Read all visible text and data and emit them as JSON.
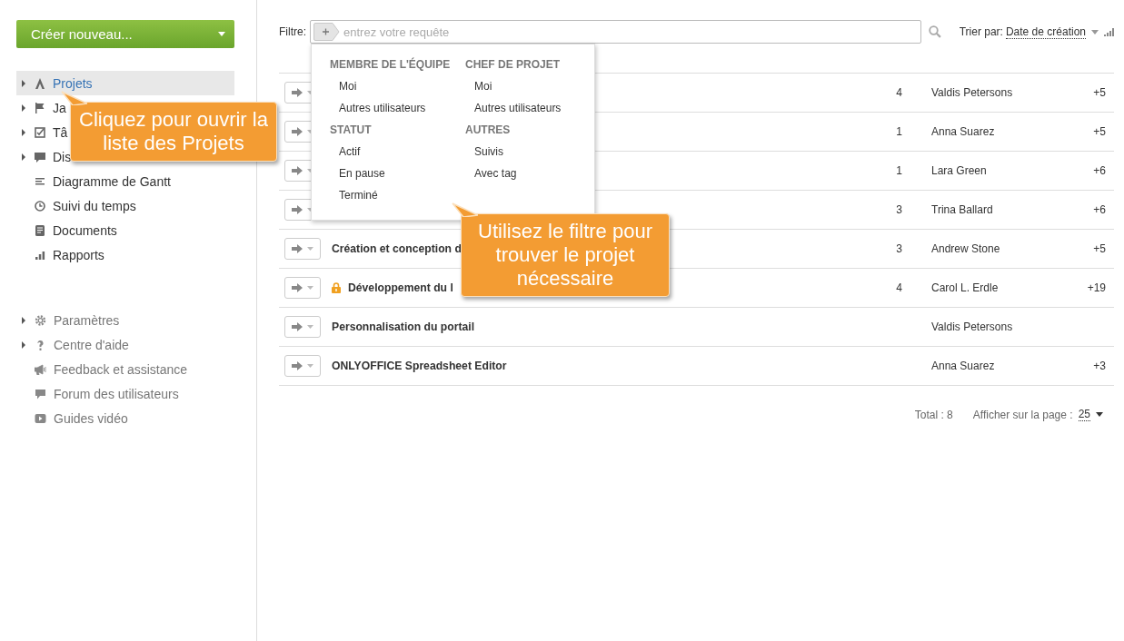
{
  "create_button": {
    "label": "Créer nouveau..."
  },
  "sidebar": {
    "items": [
      {
        "label": "Projets",
        "expandable": true,
        "selected": true
      },
      {
        "label": "Ja",
        "expandable": true,
        "selected": false
      },
      {
        "label": "Tâ",
        "expandable": true,
        "selected": false
      },
      {
        "label": "Dis",
        "expandable": true,
        "selected": false
      },
      {
        "label": "Diagramme de Gantt",
        "expandable": false,
        "selected": false
      },
      {
        "label": "Suivi du temps",
        "expandable": false,
        "selected": false
      },
      {
        "label": "Documents",
        "expandable": false,
        "selected": false
      },
      {
        "label": "Rapports",
        "expandable": false,
        "selected": false
      }
    ],
    "help_items": [
      {
        "label": "Paramètres",
        "expandable": true
      },
      {
        "label": "Centre d'aide",
        "expandable": true
      },
      {
        "label": "Feedback et assistance",
        "expandable": false
      },
      {
        "label": "Forum des utilisateurs",
        "expandable": false
      },
      {
        "label": "Guides vidéo",
        "expandable": false
      }
    ]
  },
  "filter": {
    "label": "Filtre:",
    "placeholder": "entrez votre requête"
  },
  "sort": {
    "label": "Trier par:",
    "value": "Date de création"
  },
  "filter_menu": {
    "groups": [
      {
        "title": "MEMBRE DE L'ÉQUIPE",
        "options": [
          "Moi",
          "Autres utilisateurs"
        ]
      },
      {
        "title": "CHEF DE PROJET",
        "options": [
          "Moi",
          "Autres utilisateurs"
        ]
      },
      {
        "title": "STATUT",
        "options": [
          "Actif",
          "En pause",
          "Terminé"
        ]
      },
      {
        "title": "AUTRES",
        "options": [
          "Suivis",
          "Avec tag"
        ]
      }
    ]
  },
  "projects": [
    {
      "count": "4",
      "manager": "Valdis Petersons",
      "extra": "+5"
    },
    {
      "count": "1",
      "manager": "Anna Suarez",
      "extra": "+5"
    },
    {
      "count": "1",
      "manager": "Lara Green",
      "extra": "+6"
    },
    {
      "count": "3",
      "manager": "Trina Ballard",
      "extra": "+6"
    },
    {
      "name": "Création et conception d",
      "locked": false,
      "count": "3",
      "manager": "Andrew Stone",
      "extra": "+5"
    },
    {
      "name": "Développement du l",
      "locked": true,
      "count": "4",
      "manager": "Carol L. Erdle",
      "extra": "+19"
    },
    {
      "name": "Personnalisation du portail",
      "locked": false,
      "manager": "Valdis Petersons"
    },
    {
      "name": "ONLYOFFICE Spreadsheet Editor",
      "locked": false,
      "manager": "Anna Suarez",
      "extra": "+3"
    }
  ],
  "pagination": {
    "total": "Total : 8",
    "page_size_label": "Afficher sur la page :",
    "page_size": "25"
  },
  "callouts": [
    {
      "text": "Cliquez pour ouvrir la liste des Projets"
    },
    {
      "text": "Utilisez le filtre pour trouver le projet nécessaire"
    }
  ]
}
